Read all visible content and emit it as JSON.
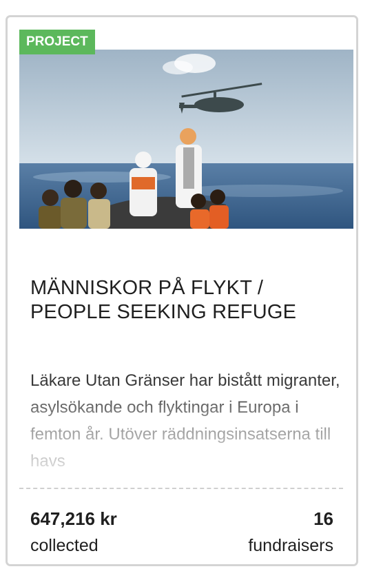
{
  "card": {
    "badge": "PROJECT",
    "image_alt": "Rescue at sea with helicopter",
    "title": "MÄNNISKOR PÅ FLYKT / PEOPLE SEEKING REFUGE",
    "description": "Läkare Utan Gränser har bistått migranter, asylsökande och flyktingar i Europa i femton år. Utöver räddningsinsatserna till havs",
    "stats": {
      "collected_value": "647,216 kr",
      "collected_label": "collected",
      "fundraisers_value": "16",
      "fundraisers_label": "fundraisers"
    },
    "colors": {
      "badge_bg": "#5cb85c",
      "border": "#d4d4d4"
    }
  }
}
